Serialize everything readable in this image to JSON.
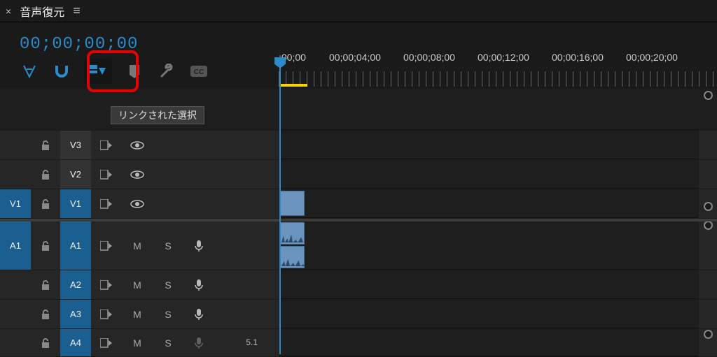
{
  "header": {
    "close": "×",
    "title": "音声復元",
    "menu": "≡"
  },
  "timecode": "00;00;00;00",
  "tooltip": "リンクされた選択",
  "ruler_labels": [
    ";00;00",
    "00;00;04;00",
    "00;00;08;00",
    "00;00;12;00",
    "00;00;16;00",
    "00;00;20;00"
  ],
  "tracks": {
    "v3": {
      "label": "V3"
    },
    "v2": {
      "label": "V2"
    },
    "v1": {
      "src": "V1",
      "label": "V1"
    },
    "a1": {
      "src": "A1",
      "label": "A1"
    },
    "a2": {
      "label": "A2"
    },
    "a3": {
      "label": "A3"
    },
    "a4": {
      "label": "A4",
      "channel": "5.1"
    }
  },
  "track_btns": {
    "mute": "M",
    "solo": "S"
  }
}
